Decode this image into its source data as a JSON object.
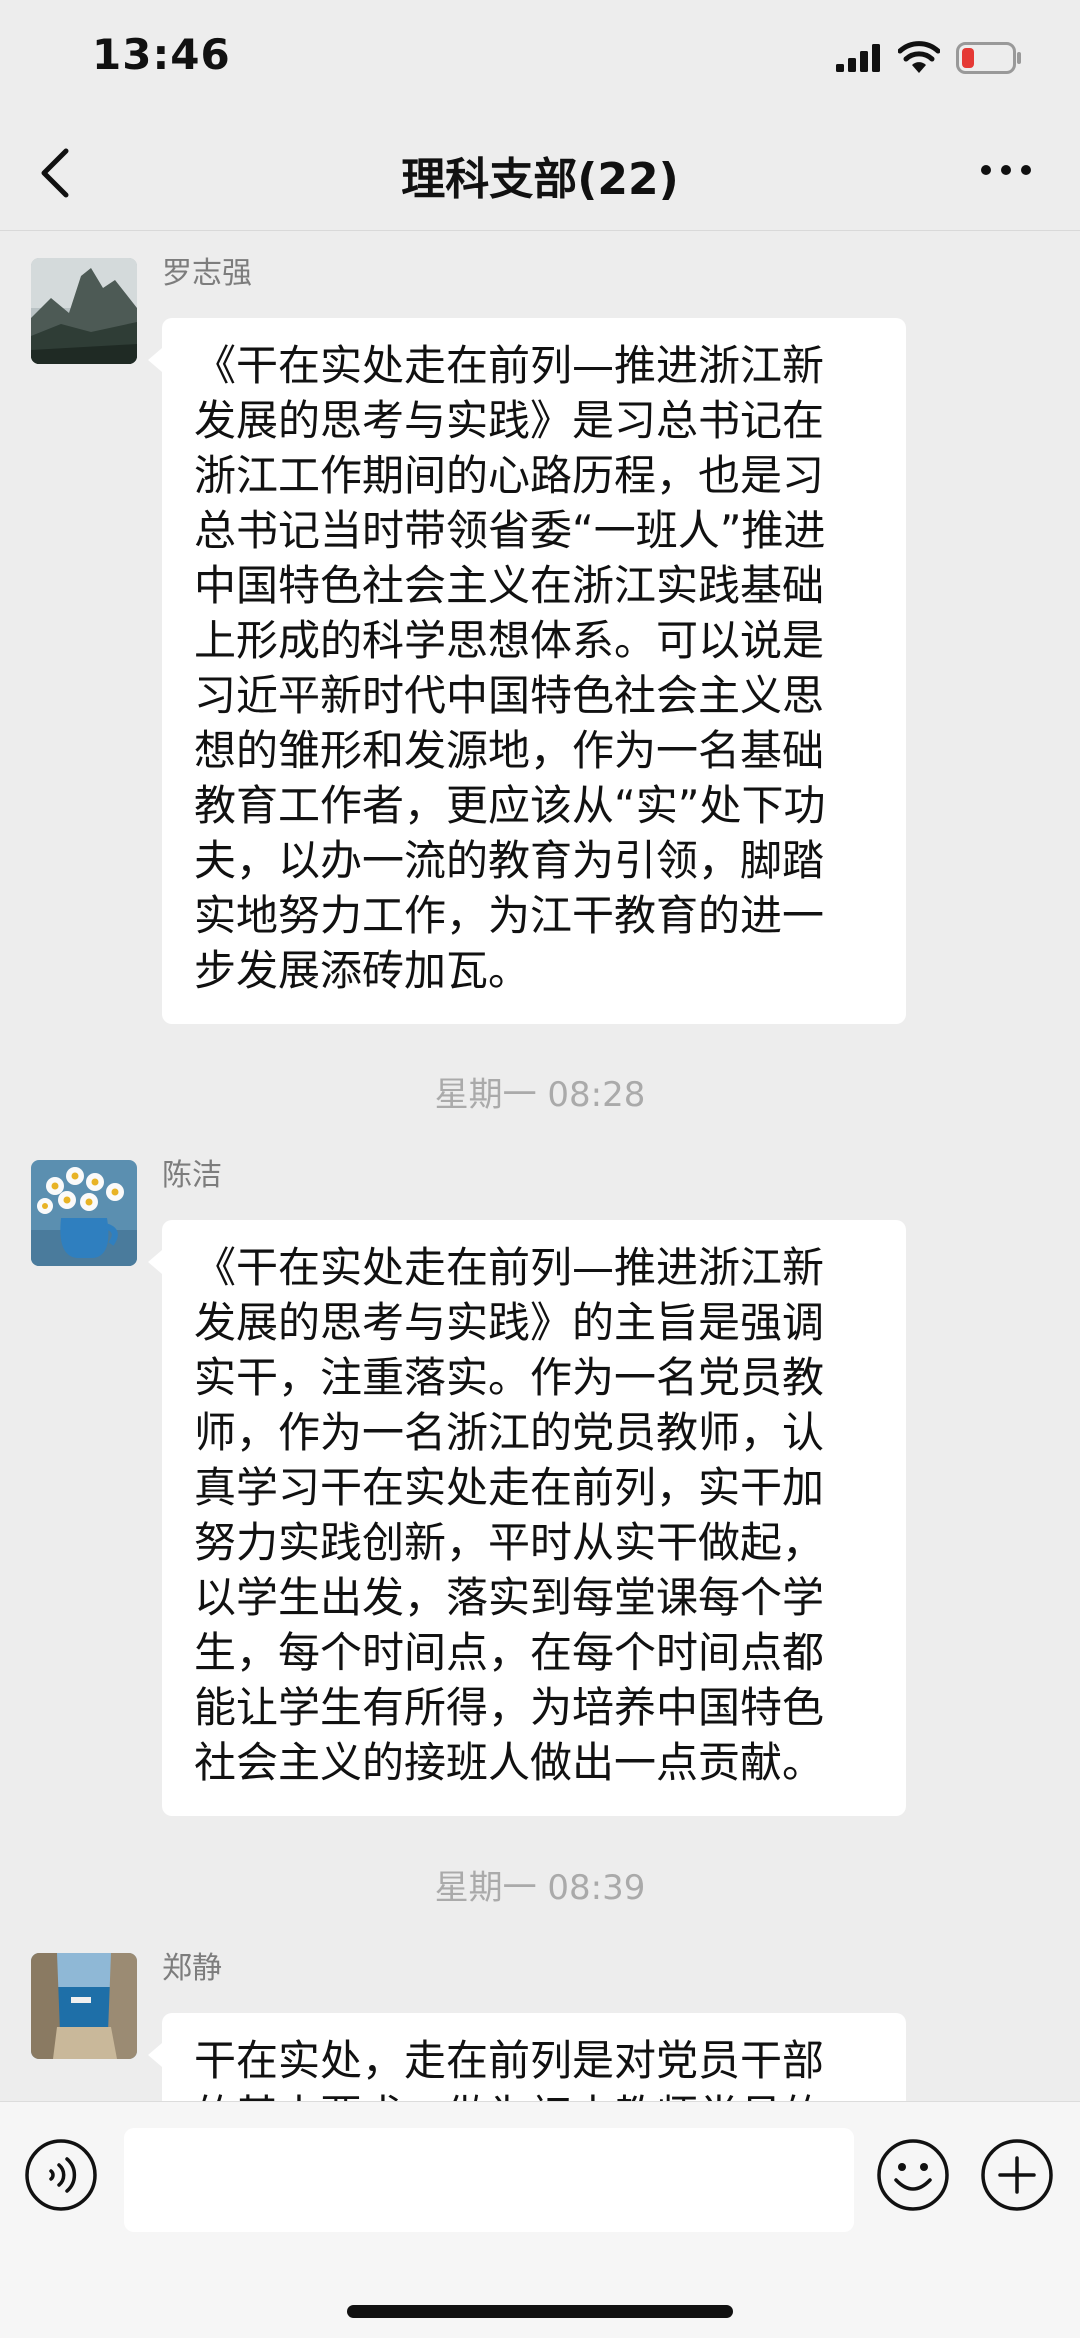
{
  "status_bar": {
    "time": "13:46"
  },
  "nav": {
    "title": "理科支部(22)"
  },
  "messages": [
    {
      "sender": "罗志强",
      "text": "《干在实处走在前列—推进浙江新\n发展的思考与实践》是习总书记在\n浙江工作期间的心路历程，也是习\n总书记当时带领省委“一班人”推进\n中国特色社会主义在浙江实践基础\n上形成的科学思想体系。可以说是\n习近平新时代中国特色社会主义思\n想的雏形和发源地，作为一名基础\n教育工作者，更应该从“实”处下功\n夫，以办一流的教育为引领，脚踏\n实地努力工作，为江干教育的进一\n步发展添砖加瓦。"
    },
    {
      "sender": "陈洁",
      "text": "《干在实处走在前列—推进浙江新\n发展的思考与实践》的主旨是强调\n实干，注重落实。作为一名党员教\n师，作为一名浙江的党员教师，认\n真学习干在实处走在前列，实干加\n努力实践创新，平时从实干做起，\n以学生出发，落实到每堂课每个学\n生，每个时间点，在每个时间点都\n能让学生有所得，为培养中国特色\n社会主义的接班人做出一点贡献。"
    },
    {
      "sender": "郑静",
      "text": "干在实处，走在前列是对党员干部\n的基本要求，做为初中教师党员的"
    }
  ],
  "time_dividers": [
    "星期一 08:28",
    "星期一 08:39"
  ],
  "input": {
    "placeholder": ""
  },
  "colors": {
    "background": "#ededed",
    "bubble": "#ffffff",
    "battery_low": "#e53935"
  }
}
